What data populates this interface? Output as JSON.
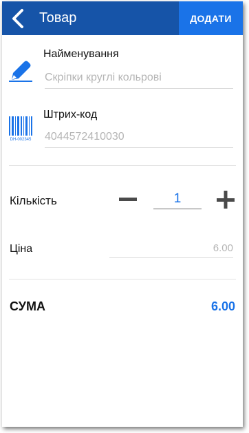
{
  "header": {
    "title": "Товар",
    "add_label": "ДОДАТИ"
  },
  "name_field": {
    "label": "Найменування",
    "value": "Скріпки круглі кольрові"
  },
  "barcode_field": {
    "label": "Штрих-код",
    "value": "4044572410030",
    "icon_caption": "DH-002345"
  },
  "quantity": {
    "label": "Кількість",
    "value": "1"
  },
  "price": {
    "label": "Ціна",
    "value": "6.00"
  },
  "total": {
    "label": "СУМА",
    "value": "6.00"
  },
  "colors": {
    "header_bg": "#1654a8",
    "add_button_bg": "#1a73e8",
    "accent": "#1a73e8"
  }
}
